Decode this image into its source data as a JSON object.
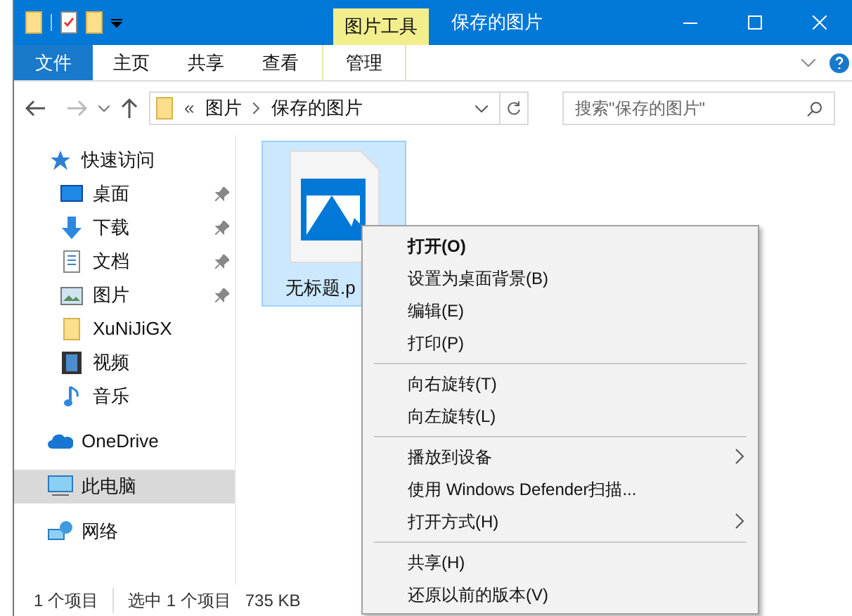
{
  "title_bar": {
    "contextual_tab": "图片工具",
    "title": "保存的图片"
  },
  "ribbon_tabs": [
    {
      "label": "文件",
      "kind": "file",
      "selected": false
    },
    {
      "label": "主页",
      "kind": "tab",
      "selected": false
    },
    {
      "label": "共享",
      "kind": "tab",
      "selected": false
    },
    {
      "label": "查看",
      "kind": "tab",
      "selected": false
    },
    {
      "label": "管理",
      "kind": "contextual",
      "selected": true
    }
  ],
  "address_bar": {
    "overflow": "«",
    "crumbs": [
      "图片",
      "保存的图片"
    ]
  },
  "search": {
    "placeholder": "搜索\"保存的图片\""
  },
  "sidebar": {
    "items": [
      {
        "label": "快速访问",
        "kind": "star",
        "selected": false,
        "children": [
          {
            "label": "桌面",
            "kind": "desktop",
            "pinned": true,
            "selected": false
          },
          {
            "label": "下载",
            "kind": "download",
            "pinned": true,
            "selected": false
          },
          {
            "label": "文档",
            "kind": "documents",
            "pinned": true,
            "selected": false
          },
          {
            "label": "图片",
            "kind": "pictures",
            "pinned": true,
            "selected": false
          },
          {
            "label": "XuNiJiGX",
            "kind": "folder",
            "pinned": false,
            "selected": false
          },
          {
            "label": "视频",
            "kind": "videos",
            "pinned": false,
            "selected": false
          },
          {
            "label": "音乐",
            "kind": "music",
            "pinned": false,
            "selected": false
          }
        ]
      },
      {
        "label": "OneDrive",
        "kind": "cloud",
        "selected": false
      },
      {
        "label": "此电脑",
        "kind": "computer",
        "selected": true
      },
      {
        "label": "网络",
        "kind": "network",
        "selected": false
      }
    ]
  },
  "files": [
    {
      "name": "无标题.p",
      "selected": true
    }
  ],
  "context_menu": [
    [
      {
        "label": "打开(O)",
        "default": true,
        "submenu": false
      },
      {
        "label": "设置为桌面背景(B)",
        "default": false,
        "submenu": false
      },
      {
        "label": "编辑(E)",
        "default": false,
        "submenu": false
      },
      {
        "label": "打印(P)",
        "default": false,
        "submenu": false
      }
    ],
    [
      {
        "label": "向右旋转(T)",
        "default": false,
        "submenu": false
      },
      {
        "label": "向左旋转(L)",
        "default": false,
        "submenu": false
      }
    ],
    [
      {
        "label": "播放到设备",
        "default": false,
        "submenu": true
      },
      {
        "label": "使用 Windows Defender扫描...",
        "default": false,
        "submenu": false
      },
      {
        "label": "打开方式(H)",
        "default": false,
        "submenu": true
      }
    ],
    [
      {
        "label": "共享(H)",
        "default": false,
        "submenu": false
      },
      {
        "label": "还原以前的版本(V)",
        "default": false,
        "submenu": false
      }
    ]
  ],
  "status_bar": [
    "1 个项目",
    "选中 1 个项目",
    "735 KB"
  ]
}
